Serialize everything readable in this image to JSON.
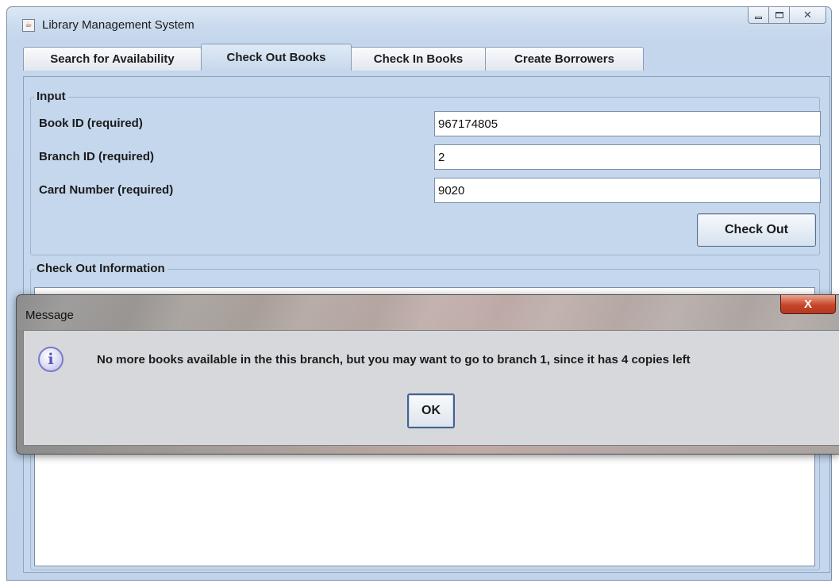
{
  "window": {
    "title": "Library Management System",
    "minimize_glyph": "",
    "close_glyph": "✕"
  },
  "tabs": [
    {
      "label": "Search for Availability"
    },
    {
      "label": "Check Out Books",
      "active": true
    },
    {
      "label": "Check In Books"
    },
    {
      "label": "Create Borrowers"
    }
  ],
  "input_group": {
    "title": "Input",
    "fields": [
      {
        "label": "Book ID (required)",
        "value": "967174805"
      },
      {
        "label": "Branch ID (required)",
        "value": "2"
      },
      {
        "label": "Card Number (required)",
        "value": "9020"
      }
    ],
    "checkout_label": "Check Out"
  },
  "info_group": {
    "title": "Check Out Information"
  },
  "dialog": {
    "title": "Message",
    "close_glyph": "X",
    "icon_glyph": "i",
    "message": "No more books available in the this branch, but you may want to go to branch 1, since it has 4 copies left",
    "ok_label": "OK"
  },
  "colors": {
    "window_frame": "#c4d6ec",
    "dialog_close": "#c7452a",
    "field_bg": "#ffffff"
  }
}
